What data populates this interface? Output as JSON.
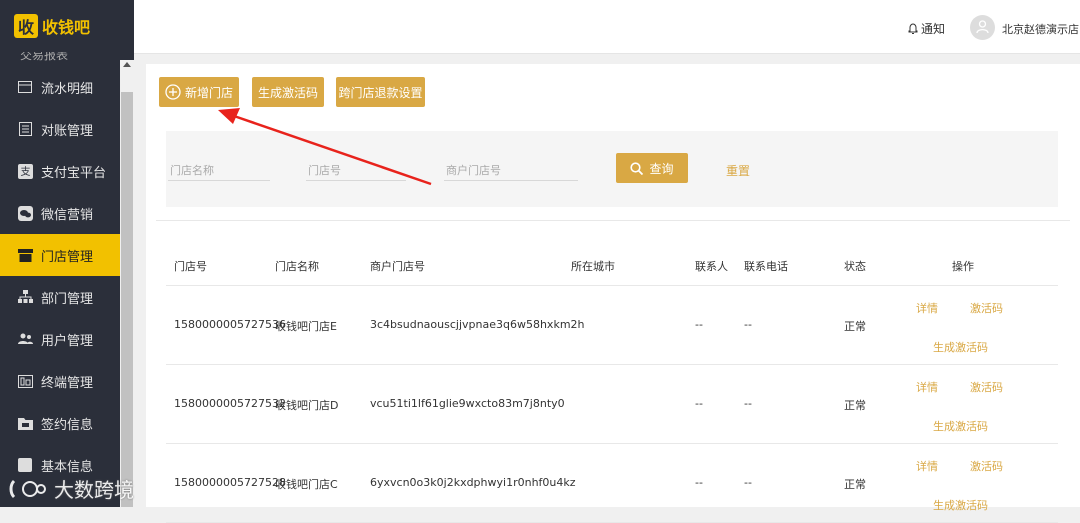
{
  "app": {
    "logo_char": "收",
    "logo_text": "收钱吧"
  },
  "sidebar": {
    "partial_item": "交易报表",
    "items": [
      {
        "label": "流水明细",
        "icon": "list-icon"
      },
      {
        "label": "对账管理",
        "icon": "ledger-icon"
      },
      {
        "label": "支付宝平台",
        "icon": "alipay-icon"
      },
      {
        "label": "微信营销",
        "icon": "wechat-icon"
      },
      {
        "label": "门店管理",
        "icon": "store-icon",
        "active": true
      },
      {
        "label": "部门管理",
        "icon": "org-icon"
      },
      {
        "label": "用户管理",
        "icon": "users-icon"
      },
      {
        "label": "终端管理",
        "icon": "terminal-icon"
      },
      {
        "label": "签约信息",
        "icon": "folder-icon"
      },
      {
        "label": "基本信息",
        "icon": "info-icon"
      }
    ]
  },
  "header": {
    "notice": "通知",
    "user": "北京赵德演示店"
  },
  "toolbar": {
    "add_store": "新增门店",
    "gen_code": "生成激活码",
    "cross_refund": "跨门店退款设置"
  },
  "filter": {
    "store_name_ph": "门店名称",
    "store_no_ph": "门店号",
    "merchant_store_no_ph": "商户门店号",
    "search": "查询",
    "reset": "重置"
  },
  "table": {
    "headers": [
      "门店号",
      "门店名称",
      "商户门店号",
      "所在城市",
      "联系人",
      "联系电话",
      "状态",
      "操作"
    ],
    "rows": [
      {
        "no": "1580000005727536",
        "name": "收钱吧门店E",
        "merchant_no": "3c4bsudnaouscjjvpnae3q6w58hxkm2h",
        "city": "",
        "contact": "--",
        "phone": "--",
        "status": "正常"
      },
      {
        "no": "1580000005727532",
        "name": "收钱吧门店D",
        "merchant_no": "vcu51ti1lf61glie9wxcto83m7j8nty0",
        "city": "",
        "contact": "--",
        "phone": "--",
        "status": "正常"
      },
      {
        "no": "1580000005727528",
        "name": "收钱吧门店C",
        "merchant_no": "6yxvcn0o3k0j2kxdphwyi1r0nhf0u4kz",
        "city": "",
        "contact": "--",
        "phone": "--",
        "status": "正常"
      }
    ],
    "ops": {
      "detail": "详情",
      "activation": "激活码",
      "gen_activation": "生成激活码"
    }
  },
  "watermark": "大数跨境",
  "colors": {
    "sidebar": "#2b2f3a",
    "accent": "#f2c100",
    "button": "#d9a844",
    "arrow": "#e8231c"
  }
}
